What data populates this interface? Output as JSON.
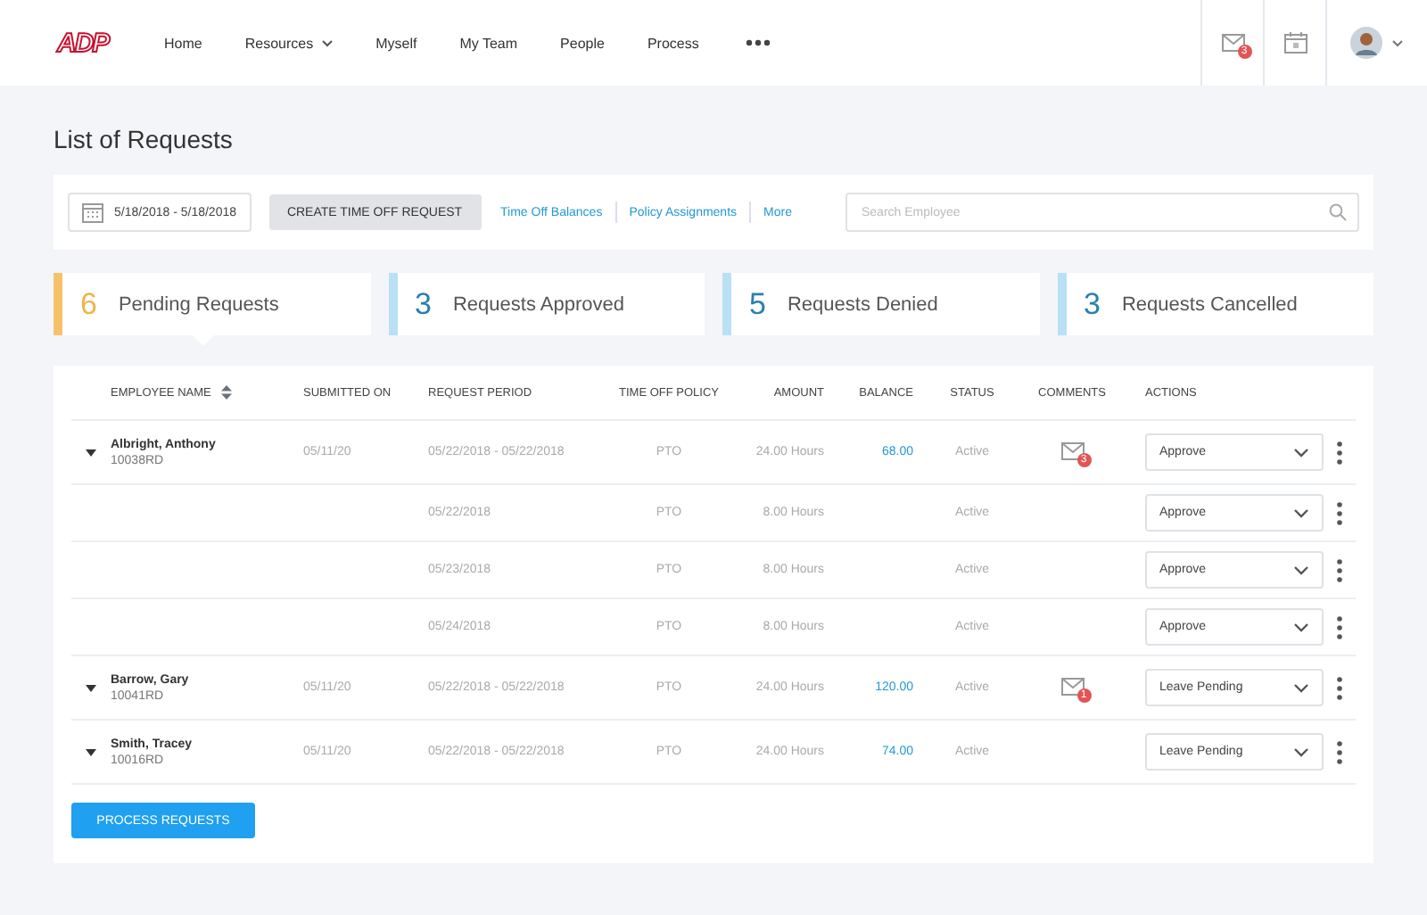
{
  "nav": {
    "logo": "ADP",
    "items": [
      {
        "label": "Home",
        "has_menu": false
      },
      {
        "label": "Resources",
        "has_menu": true
      },
      {
        "label": "Myself",
        "has_menu": false
      },
      {
        "label": "My Team",
        "has_menu": false
      },
      {
        "label": "People",
        "has_menu": false
      },
      {
        "label": "Process",
        "has_menu": false
      }
    ],
    "mail_badge": "3"
  },
  "page_title": "List of Requests",
  "toolbar": {
    "date_range": "5/18/2018 - 5/18/2018",
    "create_button": "CREATE TIME OFF REQUEST",
    "links": [
      "Time Off Balances",
      "Policy Assignments",
      "More"
    ],
    "search": {
      "placeholder": "Search Employee"
    }
  },
  "stats": [
    {
      "count": "6",
      "label": "Pending Requests",
      "color": "#f5c26b",
      "selected": true
    },
    {
      "count": "3",
      "label": "Requests Approved",
      "color": "#b9e0f5",
      "selected": false
    },
    {
      "count": "5",
      "label": "Requests Denied",
      "color": "#b9e0f5",
      "selected": false
    },
    {
      "count": "3",
      "label": "Requests Cancelled",
      "color": "#b9e0f5",
      "selected": false
    }
  ],
  "table": {
    "columns": [
      "EMPLOYEE NAME",
      "SUBMITTED ON",
      "REQUEST PERIOD",
      "TIME OFF POLICY",
      "AMOUNT",
      "BALANCE",
      "STATUS",
      "COMMENTS",
      "ACTIONS"
    ],
    "rows": [
      {
        "name": "Albright, Anthony",
        "id": "10038RD",
        "submitted": "05/11/20",
        "period": "05/22/2018 - 05/22/2018",
        "policy": "PTO",
        "amount": "24.00 Hours",
        "balance": "68.00",
        "status": "Active",
        "comments": "3",
        "action": "Approve",
        "children": [
          {
            "period": "05/22/2018",
            "policy": "PTO",
            "amount": "8.00 Hours",
            "status": "Active",
            "action": "Approve"
          },
          {
            "period": "05/23/2018",
            "policy": "PTO",
            "amount": "8.00 Hours",
            "status": "Active",
            "action": "Approve"
          },
          {
            "period": "05/24/2018",
            "policy": "PTO",
            "amount": "8.00 Hours",
            "status": "Active",
            "action": "Approve"
          }
        ]
      },
      {
        "name": "Barrow, Gary",
        "id": "10041RD",
        "submitted": "05/11/20",
        "period": "05/22/2018 - 05/22/2018",
        "policy": "PTO",
        "amount": "24.00 Hours",
        "balance": "120.00",
        "status": "Active",
        "comments": "1",
        "action": "Leave Pending"
      },
      {
        "name": "Smith, Tracey",
        "id": "10016RD",
        "submitted": "05/11/20",
        "period": "05/22/2018 - 05/22/2018",
        "policy": "PTO",
        "amount": "24.00 Hours",
        "balance": "74.00",
        "status": "Active",
        "action": "Leave Pending"
      }
    ]
  },
  "process_button": "PROCESS REQUESTS"
}
